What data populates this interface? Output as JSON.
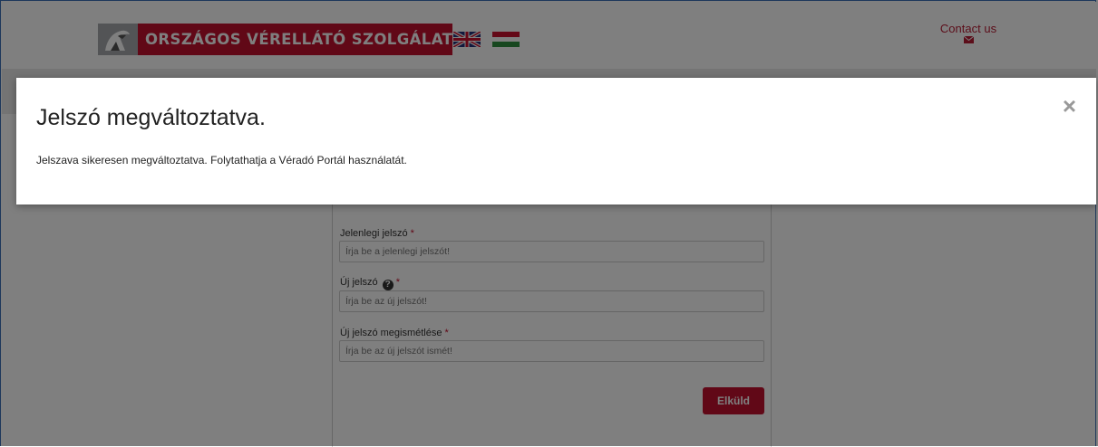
{
  "header": {
    "logo_text": "ORSZÁGOS VÉRELLÁTÓ SZOLGÁLAT",
    "contact_label": "Contact us",
    "languages": [
      "en-flag-icon",
      "hu-flag-icon"
    ]
  },
  "form": {
    "current_password_label": "Jelenlegi jelszó",
    "current_password_placeholder": "Írja be a jelenlegi jelszót!",
    "new_password_label": "Új jelszó",
    "new_password_placeholder": "Írja be az új jelszót!",
    "repeat_password_label": "Új jelszó megismétlése",
    "repeat_password_placeholder": "Írja be az új jelszót ismét!",
    "required_mark": "*",
    "help_glyph": "?",
    "submit_label": "Elküld"
  },
  "modal": {
    "title": "Jelszó megváltoztatva.",
    "body": "Jelszava sikeresen megváltoztatva. Folytathatja a Véradó Portál használatát.",
    "close_glyph": "×"
  },
  "colors": {
    "brand_red": "#c3112f",
    "link_red": "#b81c34",
    "backdrop": "rgba(0,0,0,0.5)"
  }
}
